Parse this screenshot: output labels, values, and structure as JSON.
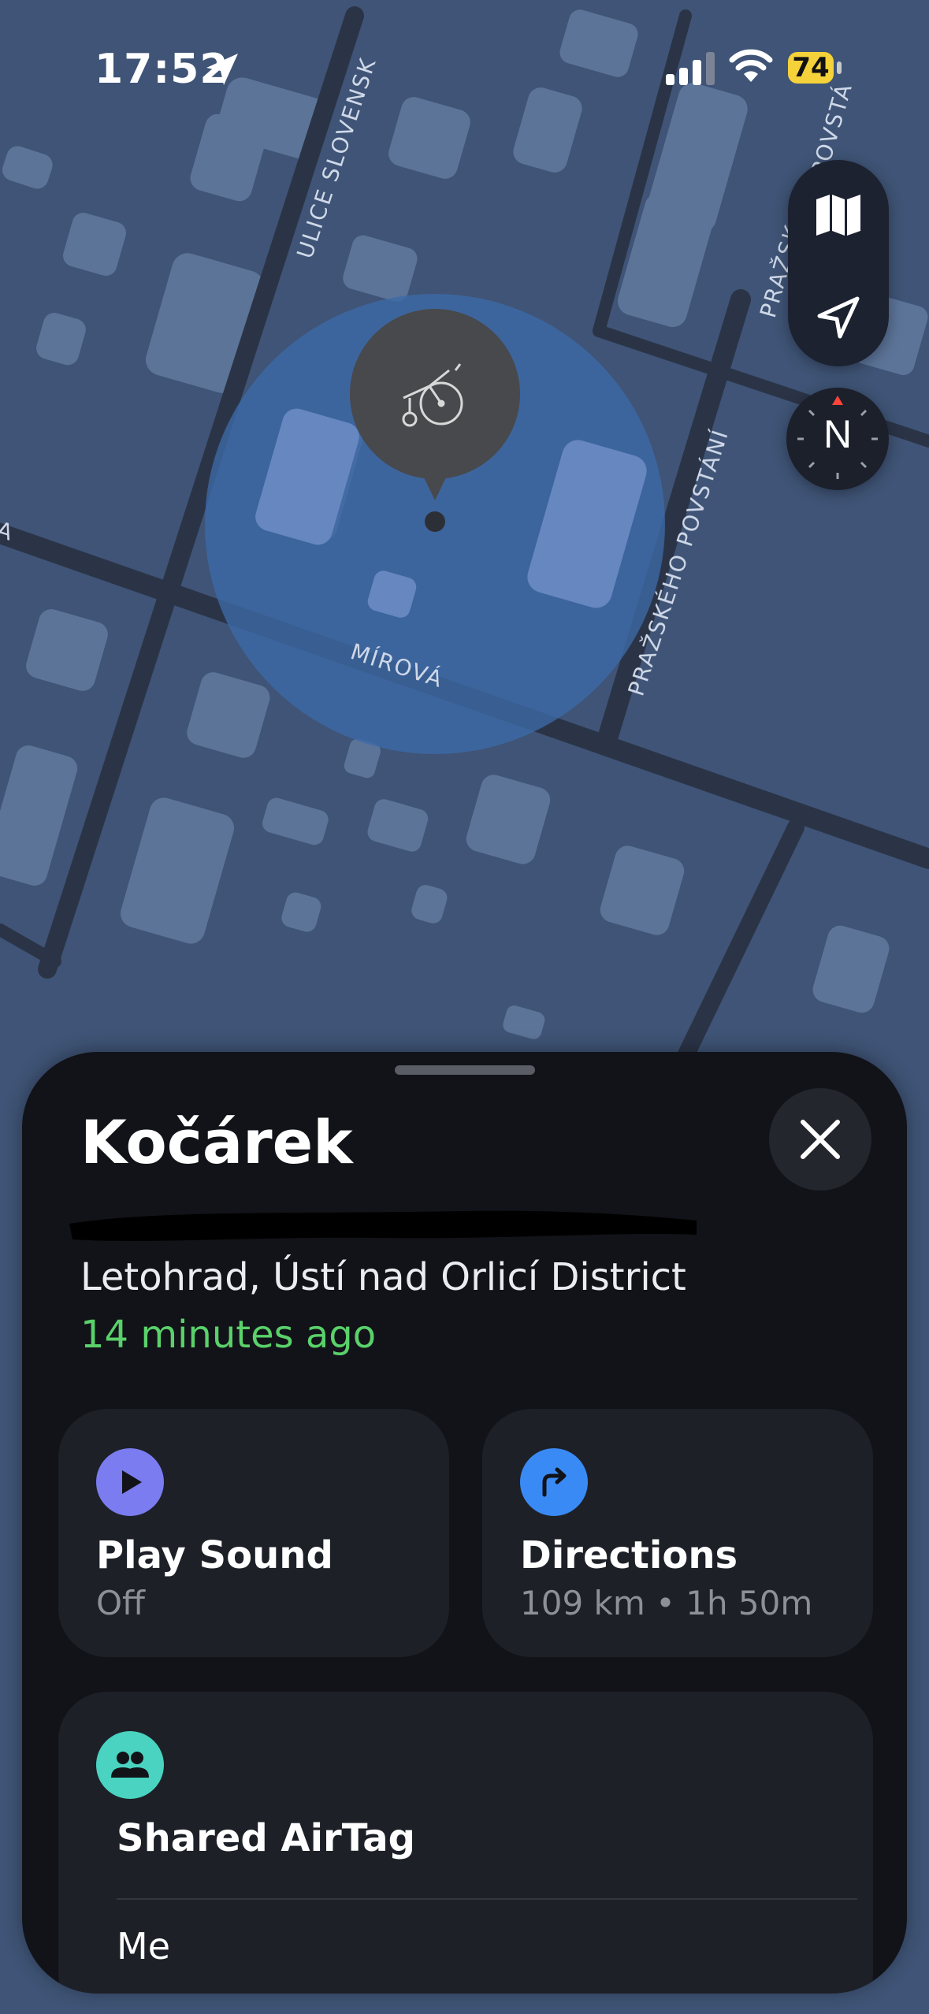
{
  "status_bar": {
    "time": "17:52",
    "battery": "74",
    "icons": [
      "location-arrow-icon",
      "cellular-signal-icon",
      "wifi-icon",
      "battery-icon"
    ]
  },
  "map": {
    "street_labels": [
      "ULICE SLOVENSK",
      "PRAŽSKÉHO POVSTÁNÍ",
      "MÍROVÁ",
      "PRAŽSK",
      "POVSTÁ",
      "A"
    ],
    "pin_icon": "stroller-icon",
    "colors": {
      "ground": "#3f5476",
      "block": "#5c7498",
      "road": "#2b3447",
      "accuracy": "#3c6aa8"
    }
  },
  "map_controls": {
    "icons": [
      "map-icon",
      "location-arrow-icon"
    ],
    "compass_label": "N"
  },
  "sheet": {
    "title": "Kočárek",
    "address": "Letohrad, Ústí nad Orlicí District",
    "last_seen": "14 minutes ago",
    "close_icon": "close-icon",
    "actions": {
      "play_sound": {
        "label": "Play Sound",
        "status": "Off",
        "icon": "play-icon",
        "color": "#7a7cf0"
      },
      "directions": {
        "label": "Directions",
        "detail": "109 km • 1h 50m",
        "icon": "turn-right-arrow-icon",
        "color": "#3a8af5"
      }
    },
    "shared": {
      "label": "Shared AirTag",
      "member": "Me",
      "icon": "people-icon",
      "color": "#49d3c0"
    }
  }
}
